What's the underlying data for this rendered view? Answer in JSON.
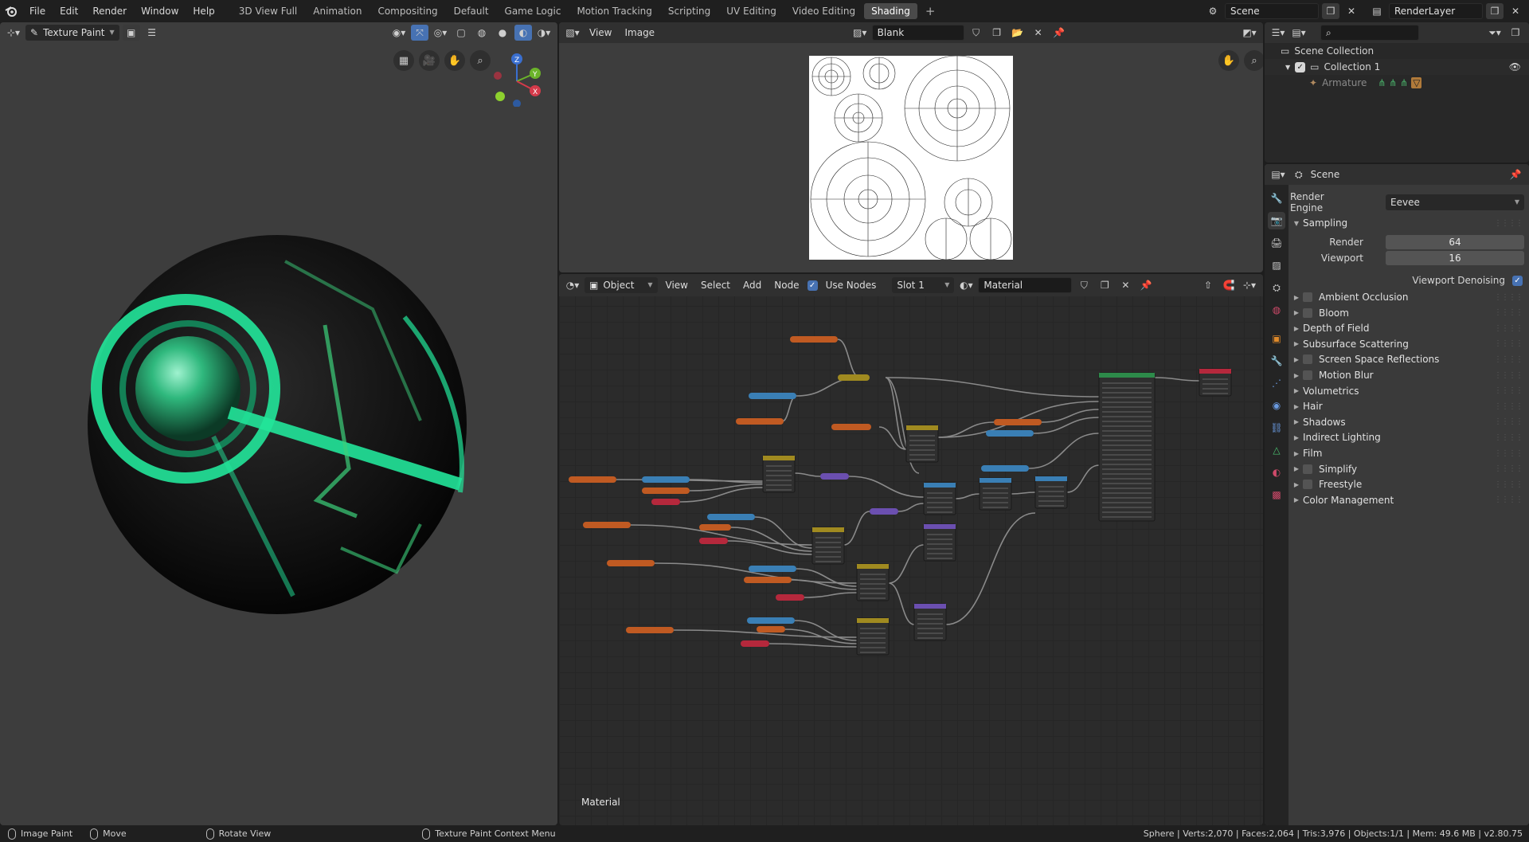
{
  "topbar": {
    "menu": [
      "File",
      "Edit",
      "Render",
      "Window",
      "Help"
    ],
    "workspaces": [
      "3D View Full",
      "Animation",
      "Compositing",
      "Default",
      "Game Logic",
      "Motion Tracking",
      "Scripting",
      "UV Editing",
      "Video Editing",
      "Shading"
    ],
    "active_workspace": "Shading",
    "scene": "Scene",
    "view_layer": "RenderLayer"
  },
  "viewport": {
    "mode": "Texture Paint"
  },
  "image_editor": {
    "menu": [
      "View",
      "Image"
    ],
    "image_name": "Blank"
  },
  "node_editor": {
    "object_type": "Object",
    "menu": [
      "View",
      "Select",
      "Add",
      "Node"
    ],
    "use_nodes_label": "Use Nodes",
    "slot": "Slot 1",
    "material": "Material",
    "footer_label": "Material"
  },
  "outliner": {
    "root": "Scene Collection",
    "collection": "Collection 1",
    "object": "Armature"
  },
  "properties": {
    "context": "Scene",
    "render_engine_label": "Render Engine",
    "render_engine": "Eevee",
    "sampling_label": "Sampling",
    "render_label": "Render",
    "render_samples": "64",
    "viewport_label": "Viewport",
    "viewport_samples": "16",
    "viewport_denoising_label": "Viewport Denoising",
    "panels": [
      {
        "label": "Ambient Occlusion",
        "checkbox": true
      },
      {
        "label": "Bloom",
        "checkbox": true
      },
      {
        "label": "Depth of Field",
        "checkbox": false
      },
      {
        "label": "Subsurface Scattering",
        "checkbox": false
      },
      {
        "label": "Screen Space Reflections",
        "checkbox": true
      },
      {
        "label": "Motion Blur",
        "checkbox": true
      },
      {
        "label": "Volumetrics",
        "checkbox": false
      },
      {
        "label": "Hair",
        "checkbox": false
      },
      {
        "label": "Shadows",
        "checkbox": false
      },
      {
        "label": "Indirect Lighting",
        "checkbox": false
      },
      {
        "label": "Film",
        "checkbox": false
      },
      {
        "label": "Simplify",
        "checkbox": true
      },
      {
        "label": "Freestyle",
        "checkbox": true
      },
      {
        "label": "Color Management",
        "checkbox": false
      }
    ]
  },
  "statusbar": {
    "left_action": "Image Paint",
    "middle_action": "Move",
    "right_action": "Rotate View",
    "context_menu": "Texture Paint Context Menu",
    "stats": "Sphere | Verts:2,070 | Faces:2,064 | Tris:3,976 | Objects:1/1 | Mem: 49.6 MB | v2.80.75"
  },
  "colors": {
    "accent": "#4772b3",
    "active_tab": "#4a4a4a",
    "glow": "#22e59a",
    "node_orange": "#c05a22",
    "node_blue": "#3a7fb5",
    "node_red": "#b5283c",
    "node_yellow": "#a08a20",
    "node_green": "#2d8a4a",
    "node_purple": "#6b4fb0"
  }
}
